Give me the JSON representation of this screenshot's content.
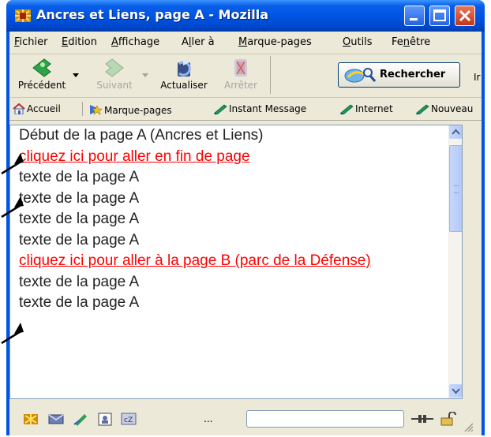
{
  "window": {
    "title": "Ancres et Liens, page A - Mozilla",
    "minimize": "_",
    "maximize": "□",
    "close": "✕"
  },
  "menu": {
    "items": [
      {
        "accel": "F",
        "rest": "ichier"
      },
      {
        "accel": "E",
        "rest": "dition"
      },
      {
        "accel": "A",
        "rest": "ffichage"
      },
      {
        "pre": "A",
        "accel": "l",
        "rest": "ler à"
      },
      {
        "accel": "M",
        "rest": "arque-pages"
      },
      {
        "accel": "O",
        "rest": "utils"
      },
      {
        "pre": "Fe",
        "accel": "n",
        "rest": "être"
      }
    ]
  },
  "nav": {
    "back": "Précédent",
    "forward": "Suivant",
    "reload": "Actualiser",
    "stop": "Arrêter",
    "search": "Rechercher",
    "print_partial": "Ir"
  },
  "bookmarks": {
    "items": [
      "Accueil",
      "Marque-pages",
      "Instant Message",
      "Internet",
      "Nouveau"
    ]
  },
  "page": {
    "lines": [
      {
        "text": "Début de la page A (Ancres et Liens)",
        "link": false
      },
      {
        "text": "cliquez ici pour aller en fin de page ",
        "link": true
      },
      {
        "text": "texte de la page A",
        "link": false
      },
      {
        "text": "texte de la page A",
        "link": false
      },
      {
        "text": "texte de la page A",
        "link": false
      },
      {
        "text": "texte de la page A",
        "link": false
      },
      {
        "text": "cliquez ici pour aller à la page B (parc de la Défense)",
        "link": true
      },
      {
        "text": "texte de la page A",
        "link": false
      },
      {
        "text": "texte de la page A",
        "link": false
      }
    ]
  },
  "status": {
    "dots": "..."
  },
  "colors": {
    "titlebar": "#0054e3",
    "chrome": "#ece9d8",
    "link": "#ff0000",
    "text": "#222222"
  }
}
